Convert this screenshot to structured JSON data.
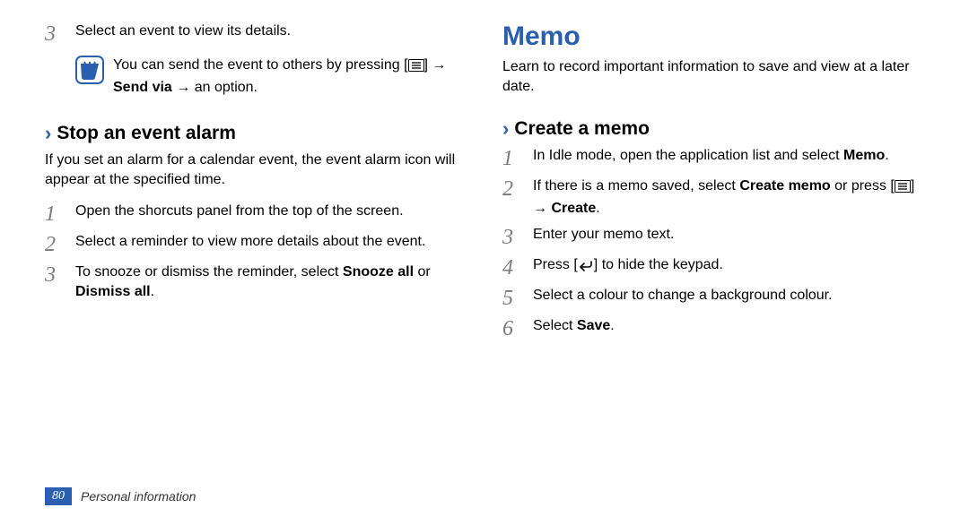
{
  "left": {
    "step3": {
      "num": "3",
      "text": "Select an event to view its details."
    },
    "note": {
      "prefix": "You can send the event to others by pressing [",
      "mid": "] → ",
      "sendvia": "Send via",
      "suffix": " → an option."
    },
    "subhead": "Stop an event alarm",
    "subdesc": "If you set an alarm for a calendar event, the event alarm icon will appear at the specified time.",
    "s1": {
      "num": "1",
      "text": "Open the shorcuts panel from the top of the screen."
    },
    "s2": {
      "num": "2",
      "text": "Select a reminder to view more details about the event."
    },
    "s3": {
      "num": "3",
      "prefix": "To snooze or dismiss the reminder, select ",
      "snooze": "Snooze all",
      "mid": " or ",
      "dismiss": "Dismiss all",
      "suffix": "."
    }
  },
  "right": {
    "title": "Memo",
    "desc": "Learn to record important information to save and view at a later date.",
    "subhead": "Create a memo",
    "s1": {
      "num": "1",
      "prefix": "In Idle mode, open the application list and select ",
      "memo": "Memo",
      "suffix": "."
    },
    "s2": {
      "num": "2",
      "prefix": "If there is a memo saved, select ",
      "creatememo": "Create memo",
      "mid1": " or press [",
      "mid2": "] → ",
      "create": "Create",
      "suffix": "."
    },
    "s3": {
      "num": "3",
      "text": "Enter your memo text."
    },
    "s4": {
      "num": "4",
      "prefix": "Press [",
      "suffix": "] to hide the keypad."
    },
    "s5": {
      "num": "5",
      "text": "Select a colour to change a background colour."
    },
    "s6": {
      "num": "6",
      "prefix": "Select ",
      "save": "Save",
      "suffix": "."
    }
  },
  "footer": {
    "page": "80",
    "chapter": "Personal information"
  }
}
